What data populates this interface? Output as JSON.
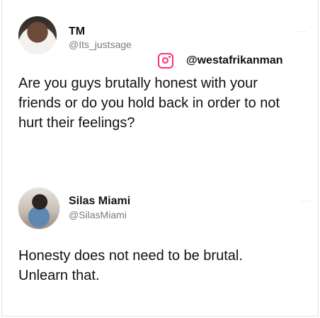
{
  "tweet1": {
    "name": "TM",
    "handle": "@Its_justsage",
    "more": "···",
    "text": "Are you guys brutally honest with your friends or do you hold back in order to not hurt their feelings?"
  },
  "watermark": {
    "icon": "instagram-icon",
    "handle": "@westafrikanman",
    "color": "#ff2d77"
  },
  "tweet2": {
    "name": "Silas Miami",
    "handle": "@SilasMiami",
    "more": "···",
    "text": "Honesty does not need to be brutal. Unlearn that."
  }
}
